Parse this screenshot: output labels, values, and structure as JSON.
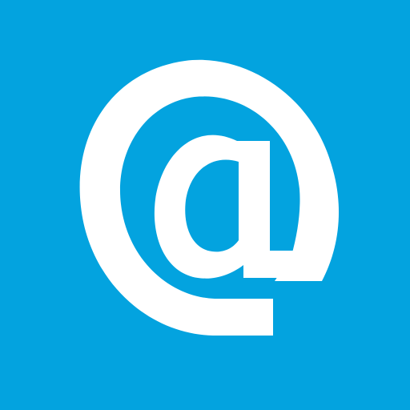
{
  "icon": {
    "name": "email-at-icon",
    "background_color": "#03a3df",
    "glyph_color": "#ffffff"
  }
}
